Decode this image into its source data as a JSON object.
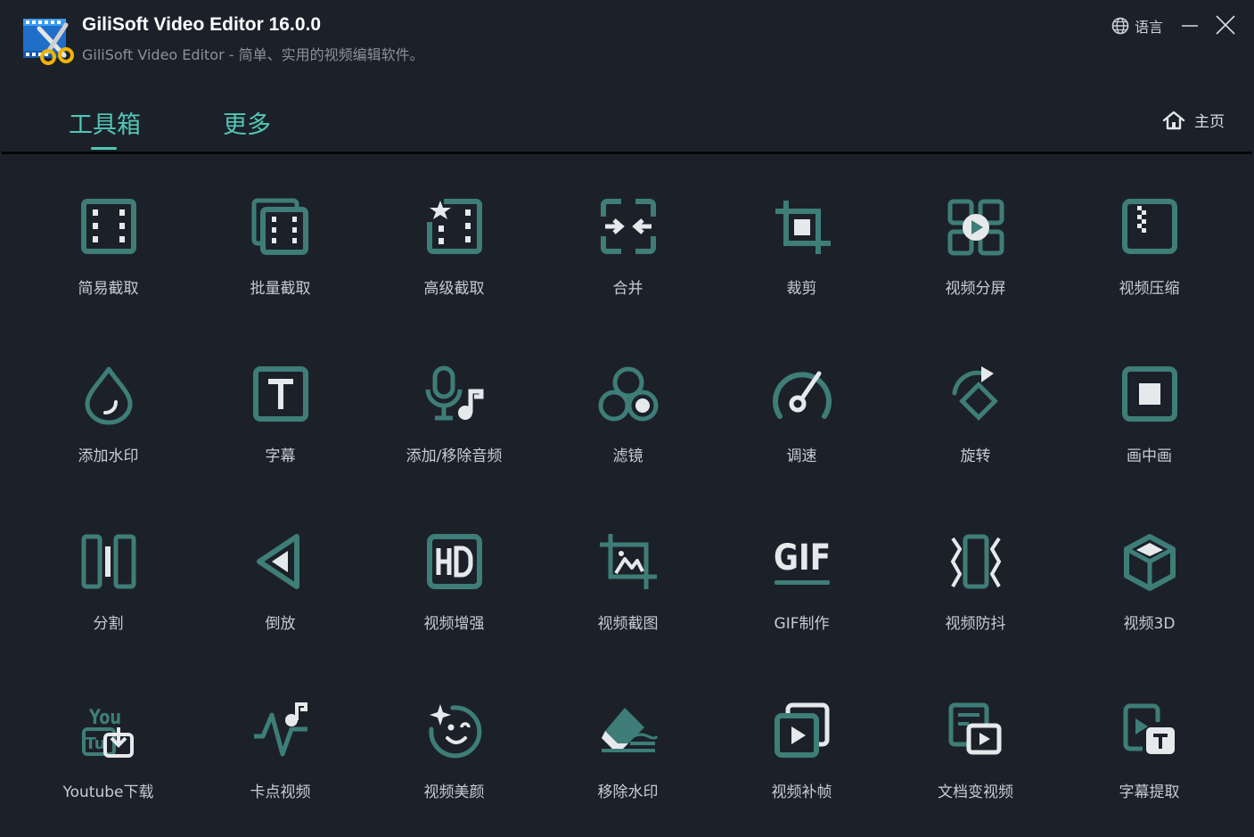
{
  "app": {
    "title": "GiliSoft Video Editor 16.0.0",
    "subtitle": "GiliSoft Video Editor - 简单、实用的视频编辑软件。",
    "language_label": "语言"
  },
  "tabs": [
    {
      "label": "工具箱",
      "active": true
    },
    {
      "label": "更多",
      "active": false
    }
  ],
  "home_label": "主页",
  "colors": {
    "accent": "#53c6b7",
    "icon": "#3e7d78",
    "background": "#1c2129"
  },
  "tools": [
    {
      "label": "简易截取",
      "icon": "film-strip-icon"
    },
    {
      "label": "批量截取",
      "icon": "batch-film-icon"
    },
    {
      "label": "高级截取",
      "icon": "advanced-film-icon"
    },
    {
      "label": "合并",
      "icon": "merge-icon"
    },
    {
      "label": "裁剪",
      "icon": "crop-icon"
    },
    {
      "label": "视频分屏",
      "icon": "split-screen-icon"
    },
    {
      "label": "视频压缩",
      "icon": "compress-icon"
    },
    {
      "label": "添加水印",
      "icon": "watermark-drop-icon"
    },
    {
      "label": "字幕",
      "icon": "subtitle-icon"
    },
    {
      "label": "添加/移除音频",
      "icon": "audio-mic-icon"
    },
    {
      "label": "滤镜",
      "icon": "filter-icon"
    },
    {
      "label": "调速",
      "icon": "speed-gauge-icon"
    },
    {
      "label": "旋转",
      "icon": "rotate-icon"
    },
    {
      "label": "画中画",
      "icon": "picture-in-picture-icon"
    },
    {
      "label": "分割",
      "icon": "split-icon"
    },
    {
      "label": "倒放",
      "icon": "reverse-icon"
    },
    {
      "label": "视频增强",
      "icon": "hd-enhance-icon"
    },
    {
      "label": "视频截图",
      "icon": "screenshot-icon"
    },
    {
      "label": "GIF制作",
      "icon": "gif-icon"
    },
    {
      "label": "视频防抖",
      "icon": "stabilize-icon"
    },
    {
      "label": "视频3D",
      "icon": "cube-3d-icon"
    },
    {
      "label": "Youtube下载",
      "icon": "youtube-download-icon"
    },
    {
      "label": "卡点视频",
      "icon": "beat-sync-icon"
    },
    {
      "label": "视频美颜",
      "icon": "beauty-face-icon"
    },
    {
      "label": "移除水印",
      "icon": "eraser-icon"
    },
    {
      "label": "视频补帧",
      "icon": "frame-interpolation-icon"
    },
    {
      "label": "文档变视频",
      "icon": "document-to-video-icon"
    },
    {
      "label": "字幕提取",
      "icon": "subtitle-extract-icon"
    }
  ]
}
